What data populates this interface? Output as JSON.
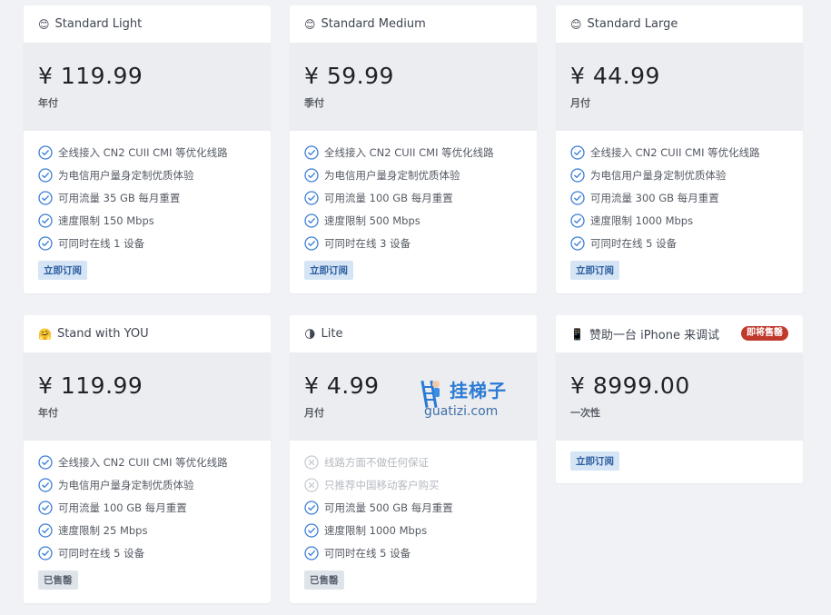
{
  "check_icon_color": "#3d7fd6",
  "x_icon_color": "#c8ccd2",
  "plans": [
    {
      "emoji": "😊",
      "title": "Standard Light",
      "price": "¥ 119.99",
      "period": "年付",
      "features": [
        {
          "text": "全线接入 CN2 CUII CMI 等优化线路",
          "ok": true
        },
        {
          "text": "为电信用户量身定制优质体验",
          "ok": true
        },
        {
          "text": "可用流量 35 GB 每月重置",
          "ok": true
        },
        {
          "text": "速度限制 150 Mbps",
          "ok": true
        },
        {
          "text": "可同时在线 1 设备",
          "ok": true
        }
      ],
      "button": "立即订阅",
      "sold_out": false
    },
    {
      "emoji": "😊",
      "title": "Standard Medium",
      "price": "¥ 59.99",
      "period": "季付",
      "features": [
        {
          "text": "全线接入 CN2 CUII CMI 等优化线路",
          "ok": true
        },
        {
          "text": "为电信用户量身定制优质体验",
          "ok": true
        },
        {
          "text": "可用流量 100 GB 每月重置",
          "ok": true
        },
        {
          "text": "速度限制 500 Mbps",
          "ok": true
        },
        {
          "text": "可同时在线 3 设备",
          "ok": true
        }
      ],
      "button": "立即订阅",
      "sold_out": false
    },
    {
      "emoji": "😊",
      "title": "Standard Large",
      "price": "¥ 44.99",
      "period": "月付",
      "features": [
        {
          "text": "全线接入 CN2 CUII CMI 等优化线路",
          "ok": true
        },
        {
          "text": "为电信用户量身定制优质体验",
          "ok": true
        },
        {
          "text": "可用流量 300 GB 每月重置",
          "ok": true
        },
        {
          "text": "速度限制 1000 Mbps",
          "ok": true
        },
        {
          "text": "可同时在线 5 设备",
          "ok": true
        }
      ],
      "button": "立即订阅",
      "sold_out": false
    },
    {
      "emoji": "🤗",
      "title": "Stand with YOU",
      "price": "¥ 119.99",
      "period": "年付",
      "features": [
        {
          "text": "全线接入 CN2 CUII CMI 等优化线路",
          "ok": true
        },
        {
          "text": "为电信用户量身定制优质体验",
          "ok": true
        },
        {
          "text": "可用流量 100 GB 每月重置",
          "ok": true
        },
        {
          "text": "速度限制 25 Mbps",
          "ok": true
        },
        {
          "text": "可同时在线 5 设备",
          "ok": true
        }
      ],
      "button": "已售罄",
      "sold_out": true
    },
    {
      "emoji": "🌗",
      "title": "Lite",
      "price": "¥ 4.99",
      "period": "月付",
      "features": [
        {
          "text": "线路方面不做任何保证",
          "ok": false
        },
        {
          "text": "只推荐中国移动客户购买",
          "ok": false
        },
        {
          "text": "可用流量 500 GB 每月重置",
          "ok": true
        },
        {
          "text": "速度限制 1000 Mbps",
          "ok": true
        },
        {
          "text": "可同时在线 5 设备",
          "ok": true
        }
      ],
      "button": "已售罄",
      "sold_out": true
    },
    {
      "emoji": "📱",
      "title": "赞助一台 iPhone 来调试",
      "price": "¥ 8999.00",
      "period": "一次性",
      "badge": "即将售罄",
      "features": [],
      "button": "立即订阅",
      "sold_out": false
    }
  ],
  "watermark": {
    "title": "挂梯子",
    "subtitle": "guatizi.com"
  }
}
